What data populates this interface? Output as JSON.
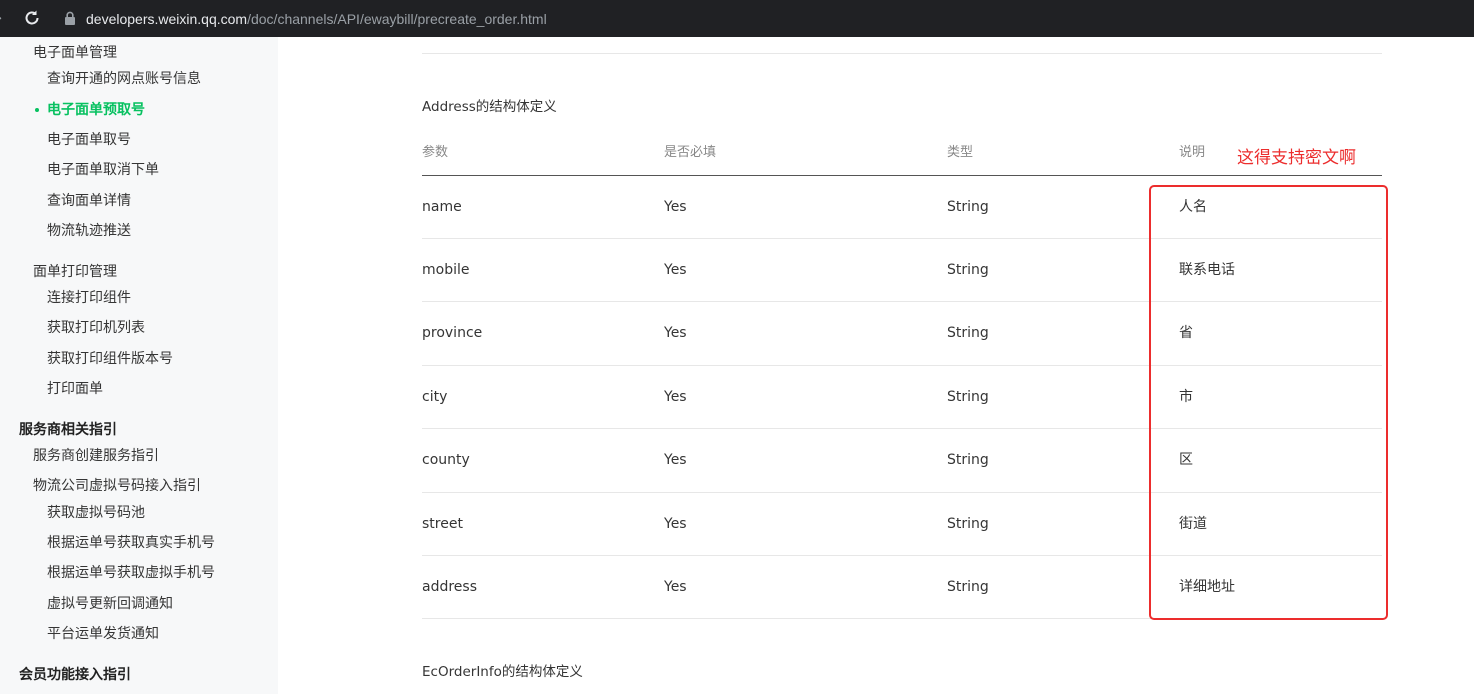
{
  "browser": {
    "url_host": "developers.weixin.qq.com",
    "url_path": "/doc/channels/API/ewaybill/precreate_order.html"
  },
  "sidebar": {
    "items": [
      {
        "label": "电子面单管理",
        "level": 1
      },
      {
        "label": "查询开通的网点账号信息",
        "level": 2
      },
      {
        "label": "电子面单预取号",
        "level": 2,
        "active": true
      },
      {
        "label": "电子面单取号",
        "level": 2
      },
      {
        "label": "电子面单取消下单",
        "level": 2
      },
      {
        "label": "查询面单详情",
        "level": 2
      },
      {
        "label": "物流轨迹推送",
        "level": 2
      },
      {
        "label": "面单打印管理",
        "level": 1
      },
      {
        "label": "连接打印组件",
        "level": 2
      },
      {
        "label": "获取打印机列表",
        "level": 2
      },
      {
        "label": "获取打印组件版本号",
        "level": 2
      },
      {
        "label": "打印面单",
        "level": 2
      },
      {
        "label": "服务商相关指引",
        "level": 0
      },
      {
        "label": "服务商创建服务指引",
        "level": 1
      },
      {
        "label": "物流公司虚拟号码接入指引",
        "level": 1
      },
      {
        "label": "获取虚拟号码池",
        "level": 2
      },
      {
        "label": "根据运单号获取真实手机号",
        "level": 2
      },
      {
        "label": "根据运单号获取虚拟手机号",
        "level": 2
      },
      {
        "label": "虚拟号更新回调通知",
        "level": 2
      },
      {
        "label": "平台运单发货通知",
        "level": 2
      },
      {
        "label": "会员功能接入指引",
        "level": 0
      }
    ]
  },
  "main": {
    "section_title": "Address的结构体定义",
    "next_section_title": "EcOrderInfo的结构体定义",
    "table": {
      "headers": [
        "参数",
        "是否必填",
        "类型",
        "说明"
      ],
      "rows": [
        [
          "name",
          "Yes",
          "String",
          "人名"
        ],
        [
          "mobile",
          "Yes",
          "String",
          "联系电话"
        ],
        [
          "province",
          "Yes",
          "String",
          "省"
        ],
        [
          "city",
          "Yes",
          "String",
          "市"
        ],
        [
          "county",
          "Yes",
          "String",
          "区"
        ],
        [
          "street",
          "Yes",
          "String",
          "街道"
        ],
        [
          "address",
          "Yes",
          "String",
          "详细地址"
        ]
      ]
    }
  },
  "annotation": {
    "text": "这得支持密文啊",
    "color": "#ec2d2d"
  },
  "colors": {
    "accent": "#07c160",
    "browser_bar": "#202124",
    "sidebar_bg": "#f7f8f9"
  }
}
